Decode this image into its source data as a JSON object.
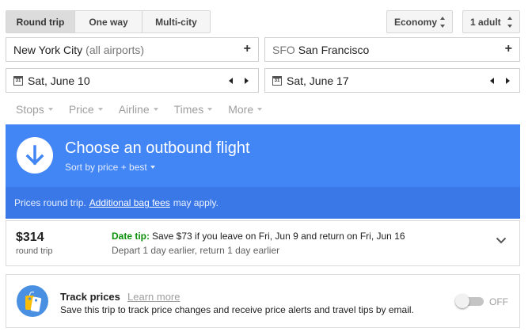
{
  "trip_type": {
    "options": [
      "Round trip",
      "One way",
      "Multi-city"
    ],
    "selected": "Round trip"
  },
  "cabin": {
    "value": "Economy"
  },
  "passengers": {
    "value": "1 adult"
  },
  "origin": {
    "city": "New York City",
    "qualifier": "(all airports)"
  },
  "destination": {
    "code": "SFO",
    "city": "San Francisco"
  },
  "dates": {
    "depart": "Sat, June 10",
    "return": "Sat, June 17",
    "calendar_glyph": "31"
  },
  "filters": [
    "Stops",
    "Price",
    "Airline",
    "Times",
    "More"
  ],
  "header": {
    "title": "Choose an outbound flight",
    "sort_label": "Sort by price + best"
  },
  "notice": {
    "prefix": "Prices round trip.",
    "link": "Additional bag fees",
    "suffix": "may apply."
  },
  "date_tip": {
    "price": "$314",
    "price_note": "round trip",
    "label": "Date tip:",
    "message": "Save $73 if you leave on Fri, Jun 9 and return on Fri, Jun 16",
    "detail": "Depart 1 day earlier, return 1 day earlier"
  },
  "track_prices": {
    "title": "Track prices",
    "learn_more": "Learn more",
    "description": "Save this trip to track price changes and receive price alerts and travel tips by email.",
    "toggle_label": "OFF",
    "enabled": false
  },
  "colors": {
    "accent_blue": "#4285f4",
    "notice_blue": "#3b78e7",
    "tip_green": "#0a8f08"
  }
}
